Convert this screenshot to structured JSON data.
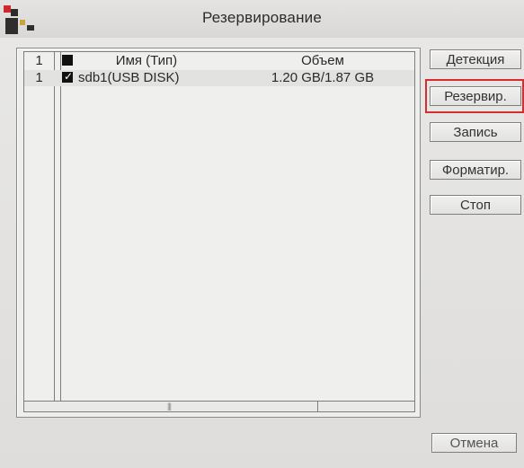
{
  "window": {
    "title": "Резервирование"
  },
  "table": {
    "header": {
      "num": "1",
      "name": "Имя (Тип)",
      "volume": "Объем"
    },
    "rows": [
      {
        "num": "1",
        "checked": true,
        "name": "sdb1(USB DISK)",
        "volume": "1.20 GB/1.87 GB"
      }
    ]
  },
  "buttons": {
    "detect": "Детекция",
    "backup": "Резервир.",
    "record": "Запись",
    "format": "Форматир.",
    "stop": "Стоп",
    "cancel": "Отмена"
  },
  "icons": {
    "header_checkbox": "checkbox-icon",
    "row_checkbox": "checkbox-checked-icon",
    "logo": "app-logo-icon"
  },
  "colors": {
    "focus_outline": "#d42e2e",
    "background": "#dcdcda"
  }
}
